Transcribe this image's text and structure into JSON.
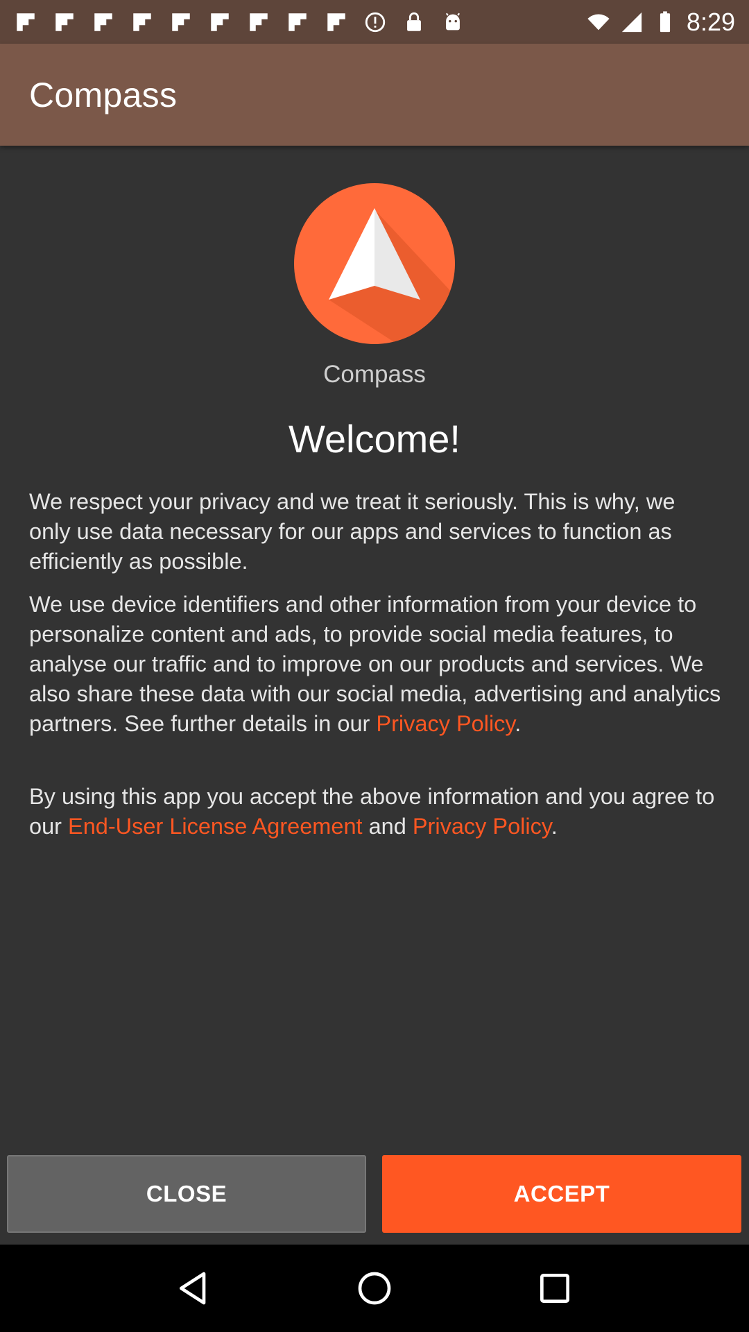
{
  "status_bar": {
    "time": "8:29",
    "left_icons": [
      "flipboard-icon",
      "flipboard-icon",
      "flipboard-icon",
      "flipboard-icon",
      "flipboard-icon",
      "flipboard-icon",
      "flipboard-icon",
      "flipboard-icon",
      "flipboard-icon",
      "alert-circle-icon",
      "lock-icon",
      "android-icon"
    ],
    "right_icons": [
      "wifi-icon",
      "signal-icon",
      "battery-icon"
    ]
  },
  "app_bar": {
    "title": "Compass"
  },
  "main": {
    "app_name": "Compass",
    "welcome": "Welcome!",
    "para1": "We respect your privacy and we treat it seriously. This is why, we only use data necessary for our apps and services to function as efficiently as possible.",
    "para2_text": "We use device identifiers and other information from your device to personalize content and ads, to provide social media features, to analyse our traffic and to improve on our products and services. We also share these data with our social media, advertising and analytics partners. See further details in our ",
    "para2_link": "Privacy Policy",
    "para2_end": ".",
    "para3_text": "By using this app you accept the above information and you agree to our ",
    "para3_link1": "End-User License Agreement",
    "para3_mid": " and ",
    "para3_link2": "Privacy Policy",
    "para3_end": "."
  },
  "buttons": {
    "close": "CLOSE",
    "accept": "ACCEPT"
  },
  "nav_bar": {
    "icons": [
      "back-icon",
      "home-icon",
      "recents-icon"
    ]
  },
  "colors": {
    "accent": "#ff5722",
    "status_bar": "#5e453a",
    "app_bar": "#7b5849",
    "background": "#333333",
    "close_button": "#636363"
  }
}
